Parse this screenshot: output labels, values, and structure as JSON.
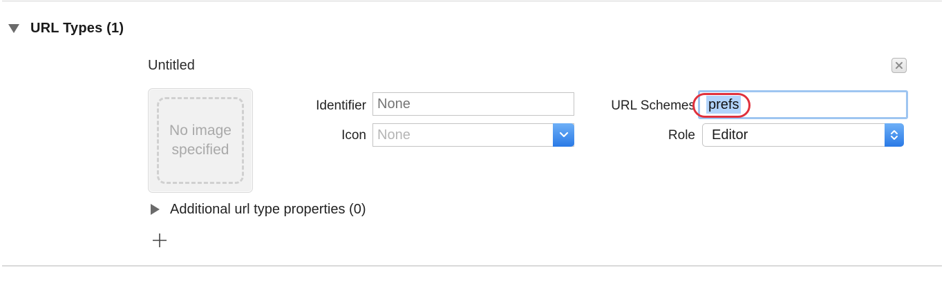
{
  "section": {
    "title": "URL Types (1)",
    "disclosure_icon": "triangle-down-icon"
  },
  "entry": {
    "title": "Untitled",
    "remove_icon": "close-icon",
    "image_well": {
      "text": "No image specified"
    },
    "identifier": {
      "label": "Identifier",
      "placeholder": "None",
      "value": ""
    },
    "icon_field": {
      "label": "Icon",
      "placeholder": "None",
      "value": ""
    },
    "url_schemes": {
      "label": "URL Schemes",
      "value": "prefs"
    },
    "role": {
      "label": "Role",
      "selected": "Editor"
    }
  },
  "additional": {
    "label": "Additional url type properties (0)",
    "disclosure_icon": "triangle-right-icon"
  },
  "add_icon": "plus-icon",
  "colors": {
    "accent": "#2a7ae6",
    "selection": "#b2d4fb",
    "focus_ring": "#9ec5f1",
    "annotation": "#e0313c"
  }
}
